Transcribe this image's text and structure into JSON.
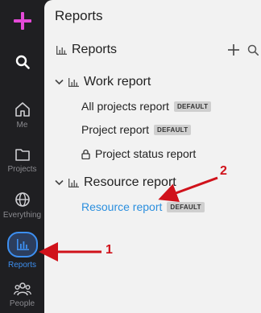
{
  "sidebar": {
    "items": [
      {
        "label": "Me"
      },
      {
        "label": "Projects"
      },
      {
        "label": "Everything"
      },
      {
        "label": "Reports"
      },
      {
        "label": "People"
      }
    ]
  },
  "panel": {
    "title": "Reports",
    "reports_header": "Reports",
    "groups": [
      {
        "label": "Work report",
        "items": [
          {
            "label": "All projects report",
            "badge": "DEFAULT"
          },
          {
            "label": "Project report",
            "badge": "DEFAULT"
          },
          {
            "label": "Project status report"
          }
        ]
      },
      {
        "label": "Resource report",
        "items": [
          {
            "label": "Resource report",
            "badge": "DEFAULT"
          }
        ]
      }
    ]
  },
  "annotations": {
    "one": "1",
    "two": "2",
    "color": "#d0121b"
  },
  "colors": {
    "accent": "#3d8ff0",
    "plus": "#e44ad8",
    "link": "#2b8fde"
  },
  "icons": [
    "plus-icon",
    "search-icon",
    "home-icon",
    "folder-icon",
    "globe-icon",
    "bar-chart-icon",
    "people-icon",
    "chevron-down-icon",
    "lock-icon"
  ]
}
